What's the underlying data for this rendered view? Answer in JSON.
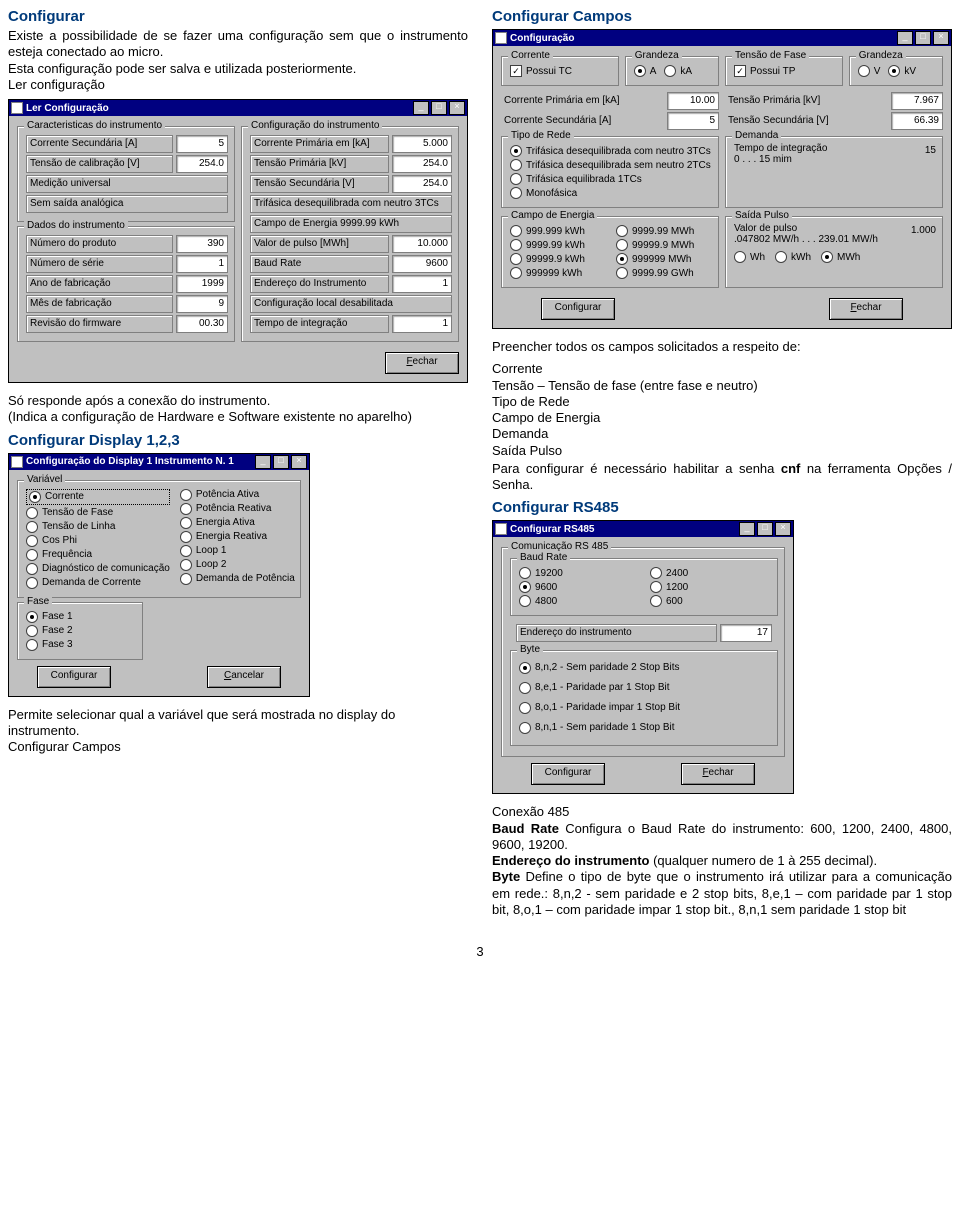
{
  "left": {
    "h_configurar": "Configurar",
    "intro": "Existe a possibilidade de se fazer uma configuração sem que o instrumento esteja conectado ao micro.\nEsta configuração pode ser salva e utilizada posteriormente.\nLer configuração",
    "win_ler": {
      "title": "Ler Configuração",
      "grp_caract": "Caracteristicas do instrumento",
      "f_corr_sec": "Corrente Secundária [A]",
      "v_corr_sec": "5",
      "f_tens_cal": "Tensão de calibração [V]",
      "v_tens_cal": "254.0",
      "f_med_univ": "Medição universal",
      "f_sem_saida": "Sem saída analógica",
      "grp_dados": "Dados do instrumento",
      "f_num_prod": "Número do produto",
      "v_num_prod": "390",
      "f_num_serie": "Número de série",
      "v_num_serie": "1",
      "f_ano": "Ano de fabricação",
      "v_ano": "1999",
      "f_mes": "Mês de fabricação",
      "v_mes": "9",
      "f_rev": "Revisão do firmware",
      "v_rev": "00.30",
      "grp_conf": "Configuração do instrumento",
      "f_cp_ka": "Corrente Primária em [kA]",
      "v_cp_ka": "5.000",
      "f_tp_kv": "Tensão Primária [kV]",
      "v_tp_kv": "254.0",
      "f_ts_v": "Tensão Secundária [V]",
      "v_ts_v": "254.0",
      "f_trif": "Trifásica desequilibrada com neutro 3TCs",
      "f_campo": "Campo de Energia 9999.99 kWh",
      "f_pulso": "Valor de pulso  [MWh]",
      "v_pulso": "10.000",
      "f_baud": "Baud Rate",
      "v_baud": "9600",
      "f_end": "Endereço do Instrumento",
      "v_end": "1",
      "f_conf_loc": "Configuração local desabilitada",
      "f_tempo": "Tempo de integração",
      "v_tempo": "1",
      "btn_fechar": "Fechar"
    },
    "after_ler": "Só responde após a conexão do instrumento.\n(Indica a configuração de Hardware e Software existente no aparelho)",
    "h_disp": "Configurar Display 1,2,3",
    "win_disp": {
      "title": "Configuração do Display 1 Instrumento N. 1",
      "grp_var": "Variável",
      "opts_l": [
        "Corrente",
        "Tensão de Fase",
        "Tensão de Linha",
        "Cos Phi",
        "Frequência",
        "Diagnóstico de comunicação",
        "Demanda de Corrente"
      ],
      "opts_r": [
        "Potência Ativa",
        "Potência Reativa",
        "Energia Ativa",
        "Energia Reativa",
        "Loop 1",
        "Loop 2",
        "Demanda de Potência"
      ],
      "sel_l": 0,
      "grp_fase": "Fase",
      "fases": [
        "Fase 1",
        "Fase 2",
        "Fase 3"
      ],
      "fase_sel": 0,
      "btn_conf": "Configurar",
      "btn_canc": "Cancelar"
    },
    "after_disp": "Permite selecionar qual a variável que será mostrada no display do instrumento.\nConfigurar Campos"
  },
  "right": {
    "h_campos": "Configurar Campos",
    "win_campos": {
      "title": "Configuração",
      "grp_corr": "Corrente",
      "chk_tc": "Possui TC",
      "grp_grand_a": "Grandeza",
      "ga": [
        "A",
        "kA"
      ],
      "ga_sel": 0,
      "grp_tf": "Tensão de Fase",
      "chk_tp": "Possui TP",
      "grp_grand_v": "Grandeza",
      "gv": [
        "V",
        "kV"
      ],
      "gv_sel": 1,
      "f_cp": "Corrente Primária em [kA]",
      "v_cp": "10.00",
      "f_cs": "Corrente Secundária [A]",
      "v_cs": "5",
      "f_tp": "Tensão Primária [kV]",
      "v_tp": "7.967",
      "f_ts": "Tensão Secundária [V]",
      "v_ts": "66.39",
      "grp_tipo": "Tipo de Rede",
      "tipos": [
        "Trifásica desequilibrada com neutro 3TCs",
        "Trifásica desequilibrada sem neutro 2TCs",
        "Trifásica equilibrada 1TCs",
        "Monofásica"
      ],
      "tipo_sel": 0,
      "grp_dem": "Demanda",
      "dem_lab": "Tempo de integração",
      "dem_range": "0 . . . 15 mim",
      "dem_val": "15",
      "grp_ce": "Campo de Energia",
      "ce_l": [
        "999.999 kWh",
        "9999.99 kWh",
        "99999.9 kWh",
        "999999 kWh"
      ],
      "ce_r": [
        "9999.99 MWh",
        "99999.9 MWh",
        "999999 MWh",
        "9999.99 GWh"
      ],
      "ce_sel": "999999 MWh",
      "grp_sp": "Saída Pulso",
      "sp_lab": "Valor de pulso",
      "sp_range": ".047802 MW/h . . . 239.01 MW/h",
      "sp_val": "1.000",
      "sp_units": [
        "Wh",
        "kWh",
        "MWh"
      ],
      "sp_sel": 2,
      "btn_conf": "Configurar",
      "btn_fechar": "Fechar"
    },
    "after_campos_lead": "Preencher todos os campos solicitados a respeito de:",
    "after_campos_lines": [
      "Corrente",
      "Tensão – Tensão de fase (entre fase e neutro)",
      "Tipo de Rede",
      "Campo de Energia",
      "Demanda",
      "Saída Pulso"
    ],
    "after_campos_tail": "Para configurar é necessário habilitar a senha <b>cnf</b> na ferramenta Opções / Senha.",
    "h_rs485": "Configurar RS485",
    "win_rs": {
      "title": "Configurar RS485",
      "grp_com": "Comunicação RS 485",
      "grp_baud": "Baud Rate",
      "baud_l": [
        "19200",
        "9600",
        "4800"
      ],
      "baud_r": [
        "2400",
        "1200",
        "600"
      ],
      "baud_sel": "9600",
      "f_end": "Endereço do instrumento",
      "v_end": "17",
      "grp_byte": "Byte",
      "bytes": [
        "8,n,2 - Sem paridade 2 Stop Bits",
        "8,e,1 - Paridade par 1 Stop Bit",
        "8,o,1 - Paridade impar 1 Stop Bit",
        "8,n,1 - Sem paridade 1 Stop Bit"
      ],
      "byte_sel": 0,
      "btn_conf": "Configurar",
      "btn_fechar": "Fechar"
    },
    "after_rs": "Conexão 485\n<b>Baud Rate</b> Configura o Baud Rate do instrumento: 600, 1200, 2400, 4800, 9600, 19200.\n<b>Endereço do instrumento</b> (qualquer numero de 1 à 255 decimal).\n<b>Byte</b> Define o tipo de byte que o instrumento irá utilizar para a comunicação em rede.: 8,n,2 - sem paridade e 2 stop bits, 8,e,1 – com paridade par 1 stop bit, 8,o,1 – com paridade impar 1 stop bit., 8,n,1 sem paridade 1 stop bit"
  },
  "page_num": "3"
}
